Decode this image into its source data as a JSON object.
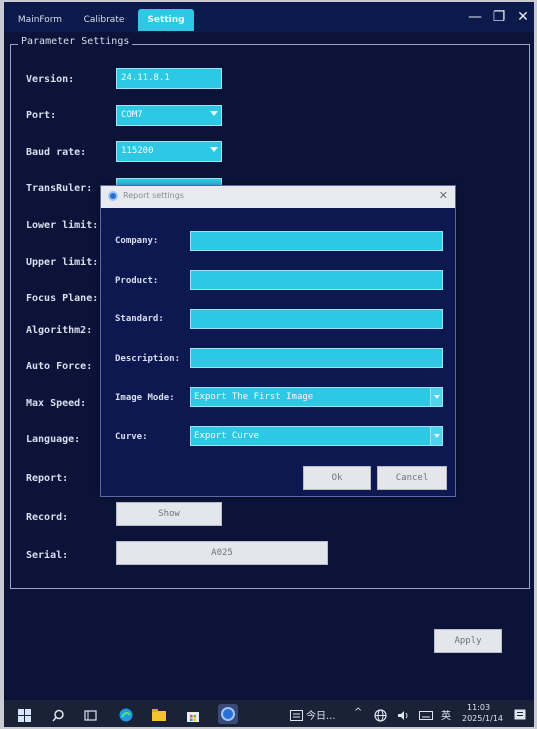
{
  "tabs": [
    {
      "label": "MainForm"
    },
    {
      "label": "Calibrate"
    },
    {
      "label": "Setting"
    }
  ],
  "window_controls": {
    "minimize": "—",
    "maximize": "❐",
    "close": "✕"
  },
  "group_title": "Parameter Settings",
  "params": {
    "version": {
      "label": "Version:",
      "value": "24.11.8.1"
    },
    "port": {
      "label": "Port:",
      "value": "COM7"
    },
    "baud": {
      "label": "Baud rate:",
      "value": "115200"
    },
    "transruler": {
      "label": "TransRuler:"
    },
    "lower": {
      "label": "Lower limit:"
    },
    "upper": {
      "label": "Upper limit:"
    },
    "focus": {
      "label": "Focus Plane:"
    },
    "algorithm": {
      "label": "Algorithm2:"
    },
    "autoforce": {
      "label": "Auto Force:"
    },
    "maxspeed": {
      "label": "Max Speed:"
    },
    "language": {
      "label": "Language:"
    },
    "report": {
      "label": "Report:"
    },
    "record": {
      "label": "Record:",
      "button": "Show"
    },
    "serial": {
      "label": "Serial:",
      "value": "A025"
    }
  },
  "apply_label": "Apply",
  "dialog": {
    "title": "Report settings",
    "close": "✕",
    "company": {
      "label": "Company:",
      "value": ""
    },
    "product": {
      "label": "Product:",
      "value": ""
    },
    "standard": {
      "label": "Standard:",
      "value": ""
    },
    "description": {
      "label": "Description:",
      "value": ""
    },
    "image_mode": {
      "label": "Image Mode:",
      "value": "Export The First Image"
    },
    "curve": {
      "label": "Curve:",
      "value": "Export Curve"
    },
    "ok": "Ok",
    "cancel": "Cancel"
  },
  "taskbar": {
    "search_box_text": "今日...",
    "chevron": "^",
    "ime": "英",
    "time": "11:03",
    "date": "2025/1/14"
  },
  "colors": {
    "background": "#0b1338",
    "accent_cyan": "#2ec8e4",
    "dialog_bg": "#0d1850",
    "taskbar": "#1a2238"
  }
}
